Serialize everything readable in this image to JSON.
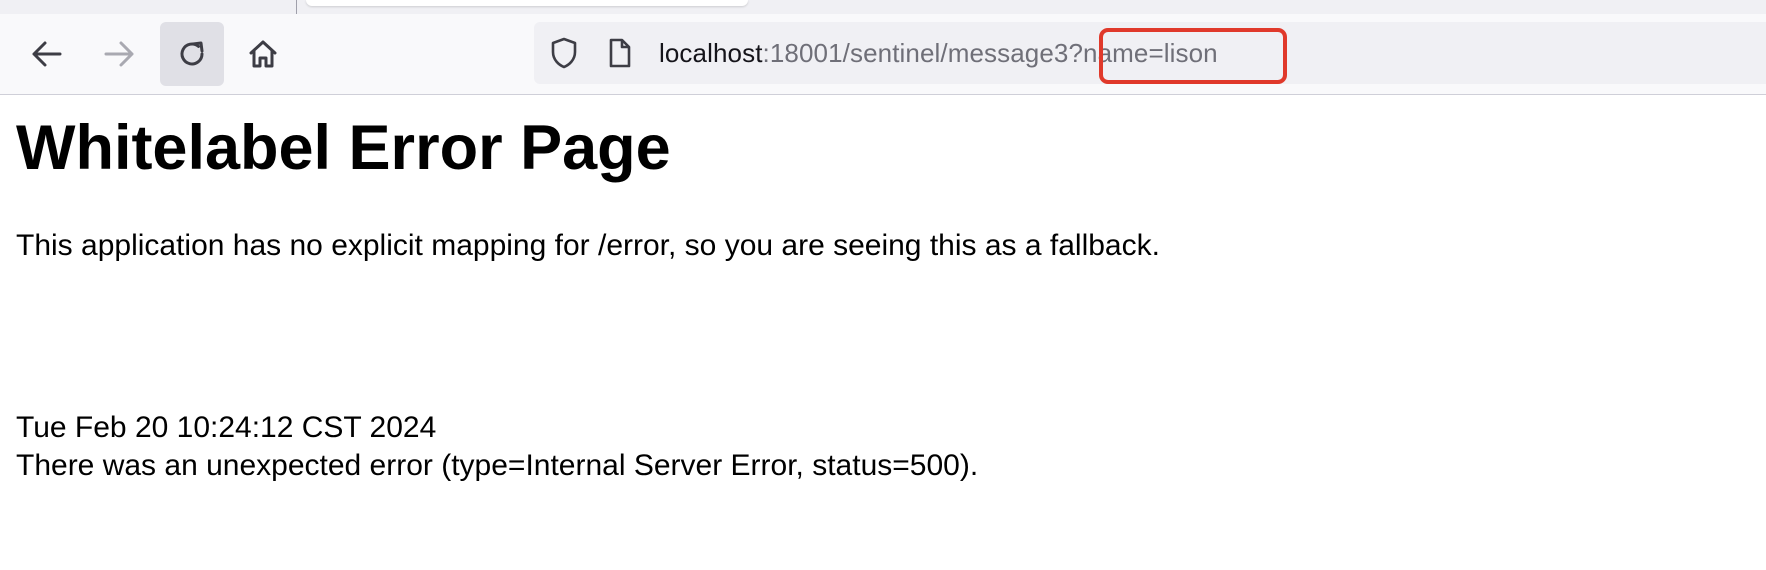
{
  "browser": {
    "url": {
      "host": "localhost",
      "path": ":18001/sentinel/message3",
      "query": "?name=lison"
    },
    "highlight_color": "#e0392b",
    "icons": [
      "back-arrow-icon",
      "forward-arrow-icon",
      "reload-icon",
      "home-icon",
      "shield-icon",
      "page-icon"
    ]
  },
  "page": {
    "title": "Whitelabel Error Page",
    "message": "This application has no explicit mapping for /error, so you are seeing this as a fallback.",
    "timestamp": "Tue Feb 20 10:24:12 CST 2024",
    "error": "There was an unexpected error (type=Internal Server Error, status=500)."
  }
}
